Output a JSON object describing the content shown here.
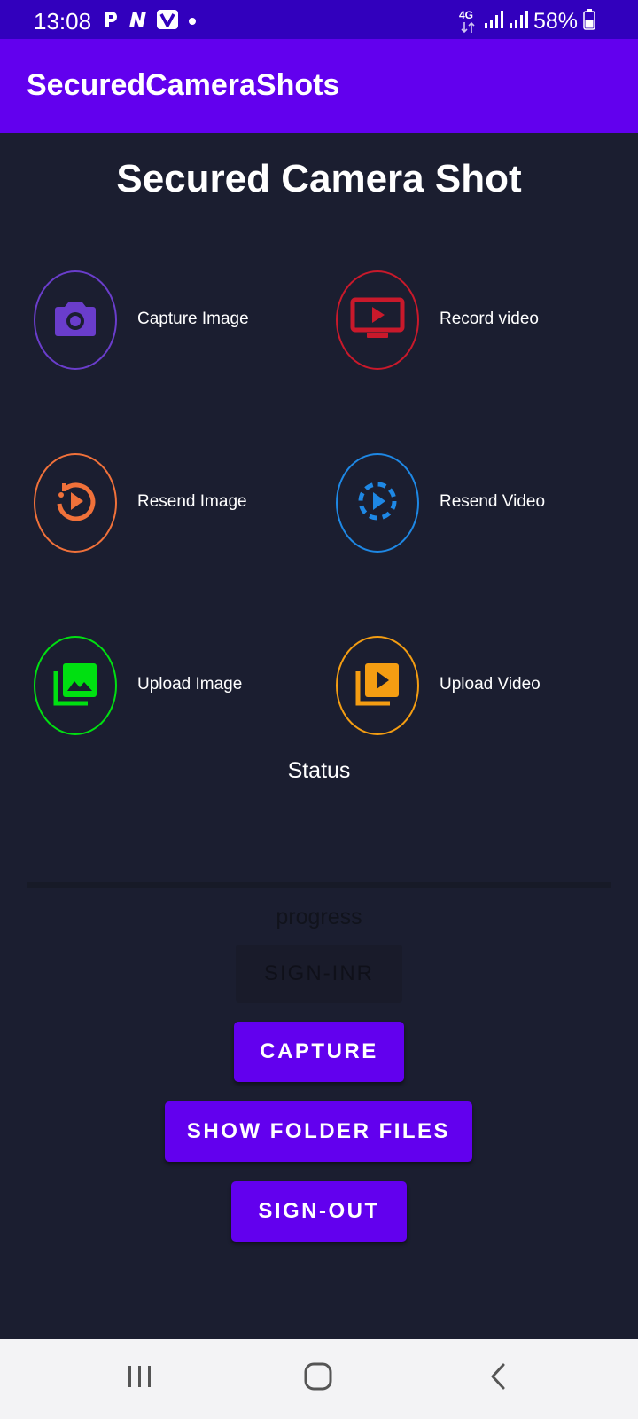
{
  "status_bar": {
    "time": "13:08",
    "notification_icons": [
      "p-icon",
      "n-icon",
      "v-icon",
      "dot-icon"
    ],
    "network": "4G",
    "battery": "58%"
  },
  "app_bar": {
    "title": "SecuredCameraShots",
    "color": "#6200ee"
  },
  "main": {
    "heading": "Secured Camera Shot",
    "actions": [
      {
        "label": "Capture Image",
        "icon": "camera-icon",
        "color": "#6a3dcb"
      },
      {
        "label": "Record video",
        "icon": "video-screen-icon",
        "color": "#c9192b"
      },
      {
        "label": "Resend Image",
        "icon": "replay-icon",
        "color": "#f0713a"
      },
      {
        "label": "Resend Video",
        "icon": "replay-dashed-icon",
        "color": "#1e88e5"
      },
      {
        "label": "Upload Image",
        "icon": "photo-library-icon",
        "color": "#00e011"
      },
      {
        "label": "Upload Video",
        "icon": "video-library-icon",
        "color": "#f49d12"
      }
    ],
    "status": "Status",
    "progress": "progress",
    "signin_label": "SIGN-INR",
    "buttons": {
      "capture": "CAPTURE",
      "show_folder_files": "SHOW FOLDER FILES",
      "sign_out": "SIGN-OUT"
    }
  },
  "nav": {
    "icons": [
      "recent-apps-icon",
      "home-icon",
      "back-icon"
    ]
  }
}
